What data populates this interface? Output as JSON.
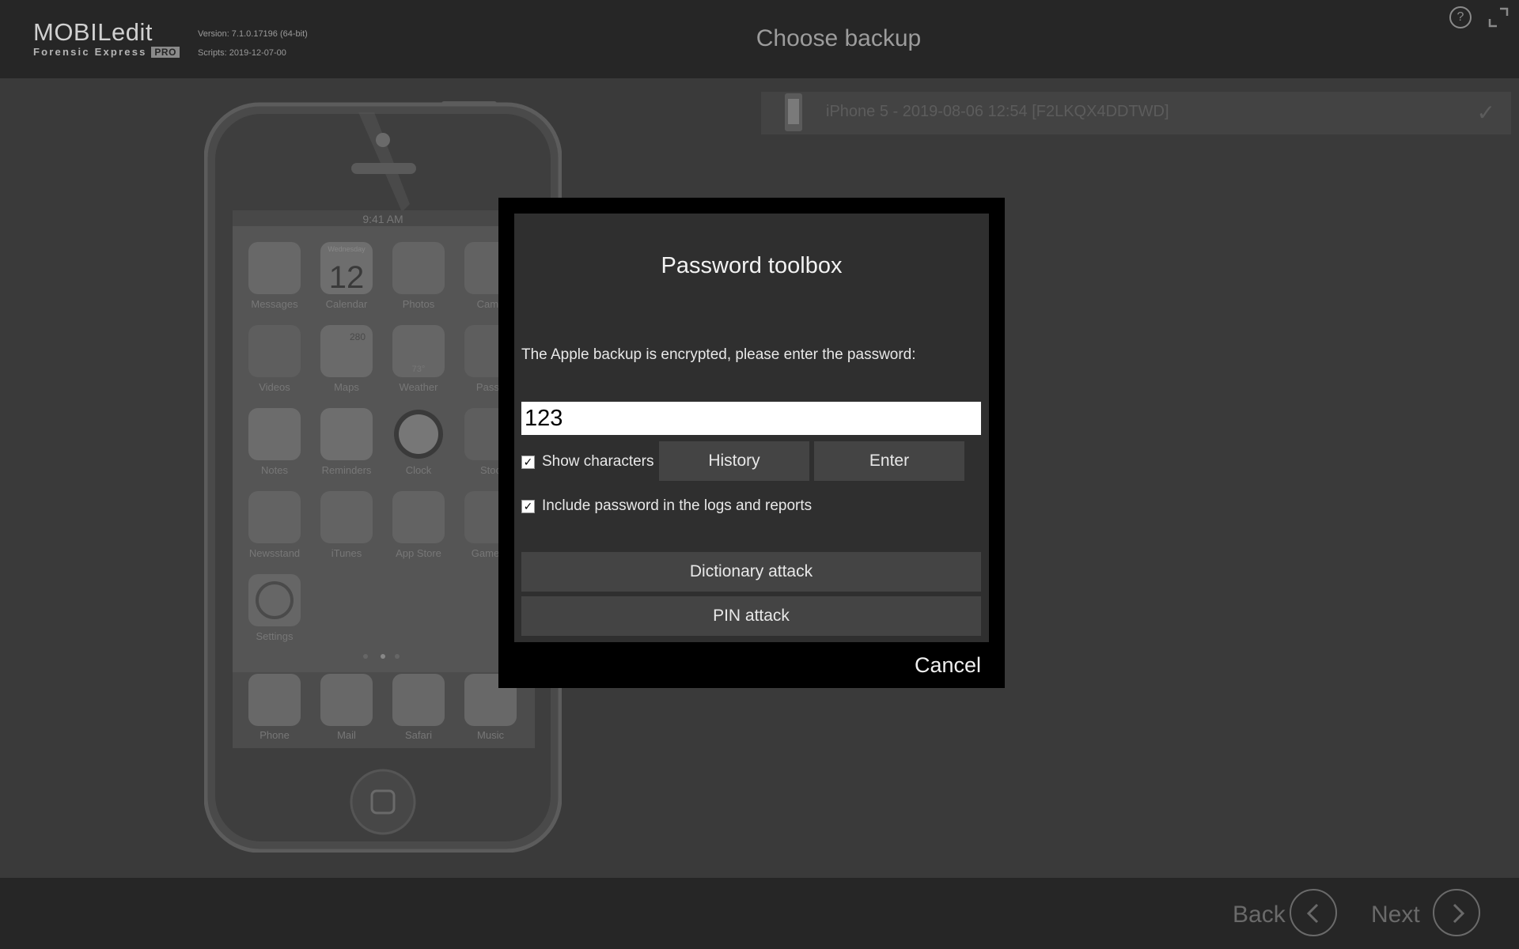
{
  "header": {
    "logo_main": "MOBILedit",
    "logo_sub": "Forensic Express",
    "logo_badge": "PRO",
    "version": "Version: 7.1.0.17196 (64-bit)",
    "scripts": "Scripts: 2019-12-07-00",
    "title": "Choose backup",
    "help_icon": "question-mark-icon",
    "fullscreen_icon": "expand-icon"
  },
  "phone_screen": {
    "time": "9:41 AM",
    "calendar_day": "Wednesday",
    "calendar_date": "12",
    "maps_badge": "280",
    "weather_temp": "73°",
    "apps": [
      {
        "label": "Messages"
      },
      {
        "label": "Calendar"
      },
      {
        "label": "Photos"
      },
      {
        "label": "Came"
      },
      {
        "label": "Videos"
      },
      {
        "label": "Maps"
      },
      {
        "label": "Weather"
      },
      {
        "label": "Passb"
      },
      {
        "label": "Notes"
      },
      {
        "label": "Reminders"
      },
      {
        "label": "Clock"
      },
      {
        "label": "Stoc"
      },
      {
        "label": "Newsstand"
      },
      {
        "label": "iTunes"
      },
      {
        "label": "App Store"
      },
      {
        "label": "Game C"
      },
      {
        "label": "Settings"
      }
    ],
    "dock": [
      {
        "label": "Phone"
      },
      {
        "label": "Mail"
      },
      {
        "label": "Safari"
      },
      {
        "label": "Music"
      }
    ]
  },
  "backups": [
    {
      "label": "iPhone 5 - 2019-08-06 12:54 [F2LKQX4DDTWD]",
      "check": "✓"
    }
  ],
  "dialog": {
    "title": "Password toolbox",
    "message": "The Apple backup is encrypted, please enter the password:",
    "password_value": "123",
    "show_characters": {
      "label": "Show characters",
      "checked": true
    },
    "include_password": {
      "label": "Include password in the logs and reports",
      "checked": true
    },
    "history_label": "History",
    "enter_label": "Enter",
    "dictionary_label": "Dictionary attack",
    "pin_label": "PIN attack",
    "cancel_label": "Cancel",
    "check_glyph": "✓"
  },
  "footer": {
    "back_label": "Back",
    "next_label": "Next",
    "back_icon": "chevron-left-icon",
    "next_icon": "chevron-right-icon"
  }
}
